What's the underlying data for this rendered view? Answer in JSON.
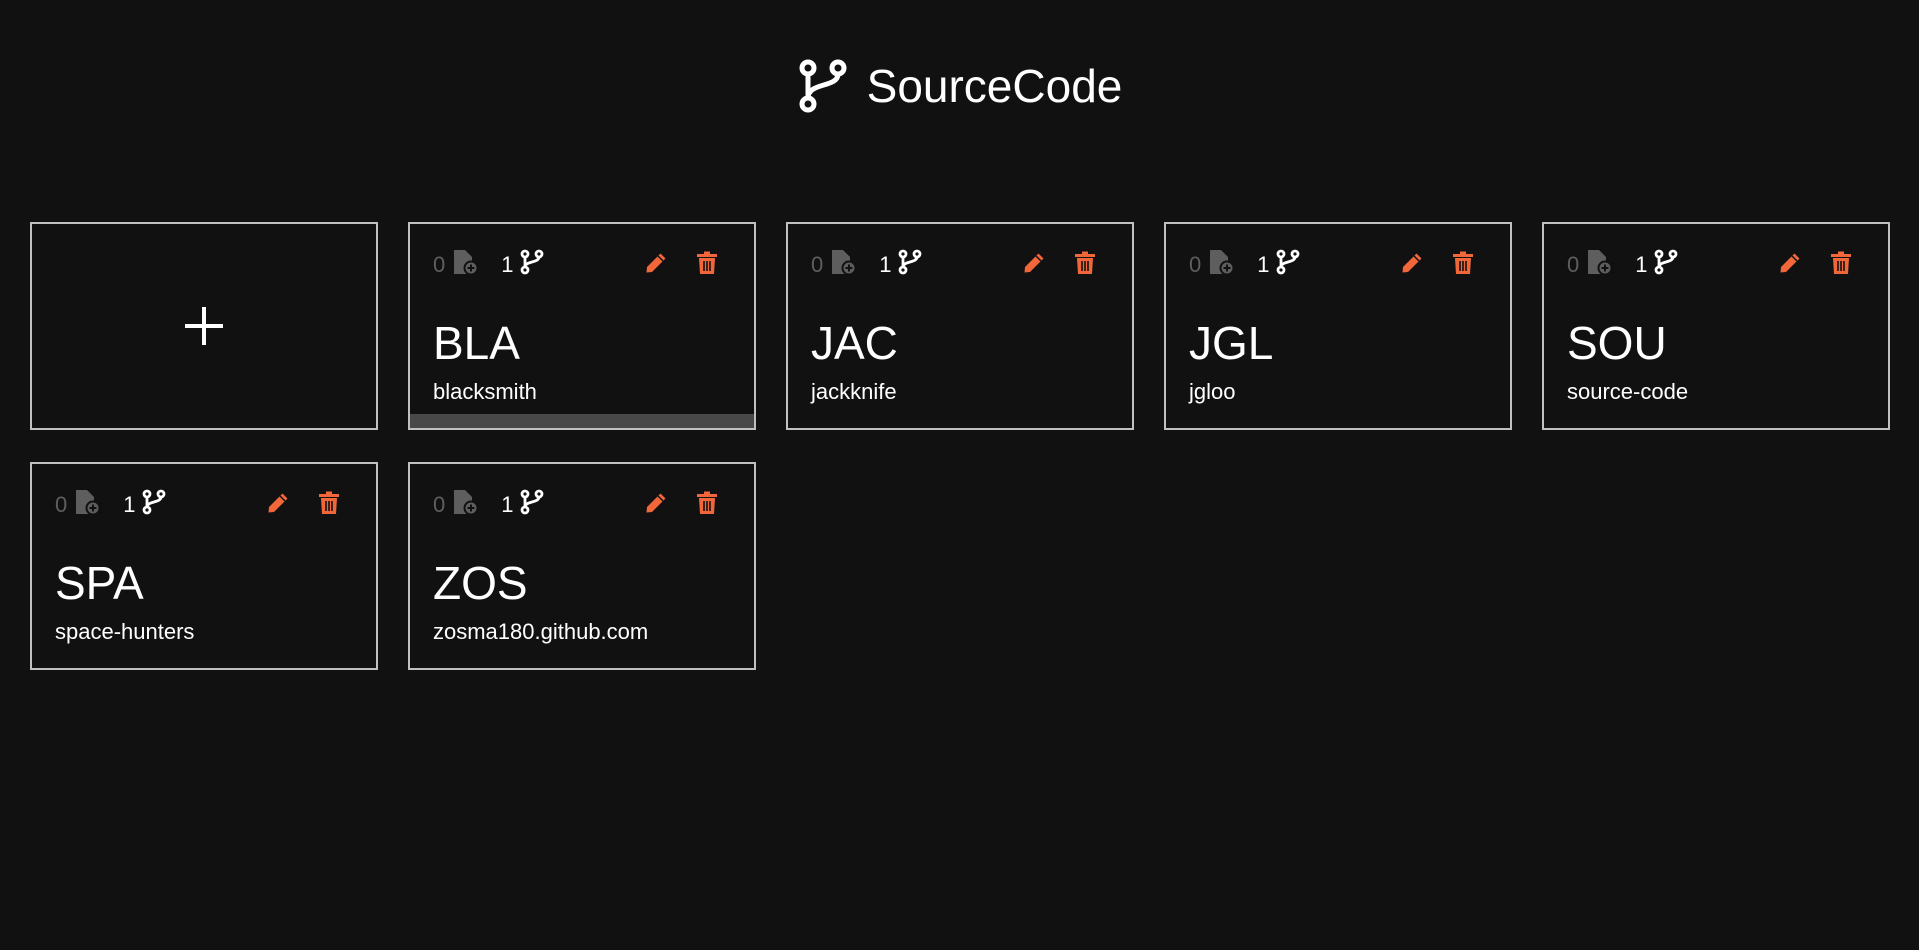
{
  "app": {
    "title": "SourceCode",
    "logo_icon": "git-branch-icon"
  },
  "colors": {
    "background": "#111111",
    "card_border": "#c0c0c0",
    "accent_orange": "#f2673a",
    "muted_gray": "#5e5e5e"
  },
  "add_card": {
    "icon": "plus-icon"
  },
  "projects": [
    {
      "code": "BLA",
      "name": "blacksmith",
      "files": "0",
      "branches": "1",
      "selected": true
    },
    {
      "code": "JAC",
      "name": "jackknife",
      "files": "0",
      "branches": "1"
    },
    {
      "code": "JGL",
      "name": "jgloo",
      "files": "0",
      "branches": "1"
    },
    {
      "code": "SOU",
      "name": "source-code",
      "files": "0",
      "branches": "1"
    },
    {
      "code": "SPA",
      "name": "space-hunters",
      "files": "0",
      "branches": "1"
    },
    {
      "code": "ZOS",
      "name": "zosma180.github.com",
      "files": "0",
      "branches": "1"
    }
  ]
}
